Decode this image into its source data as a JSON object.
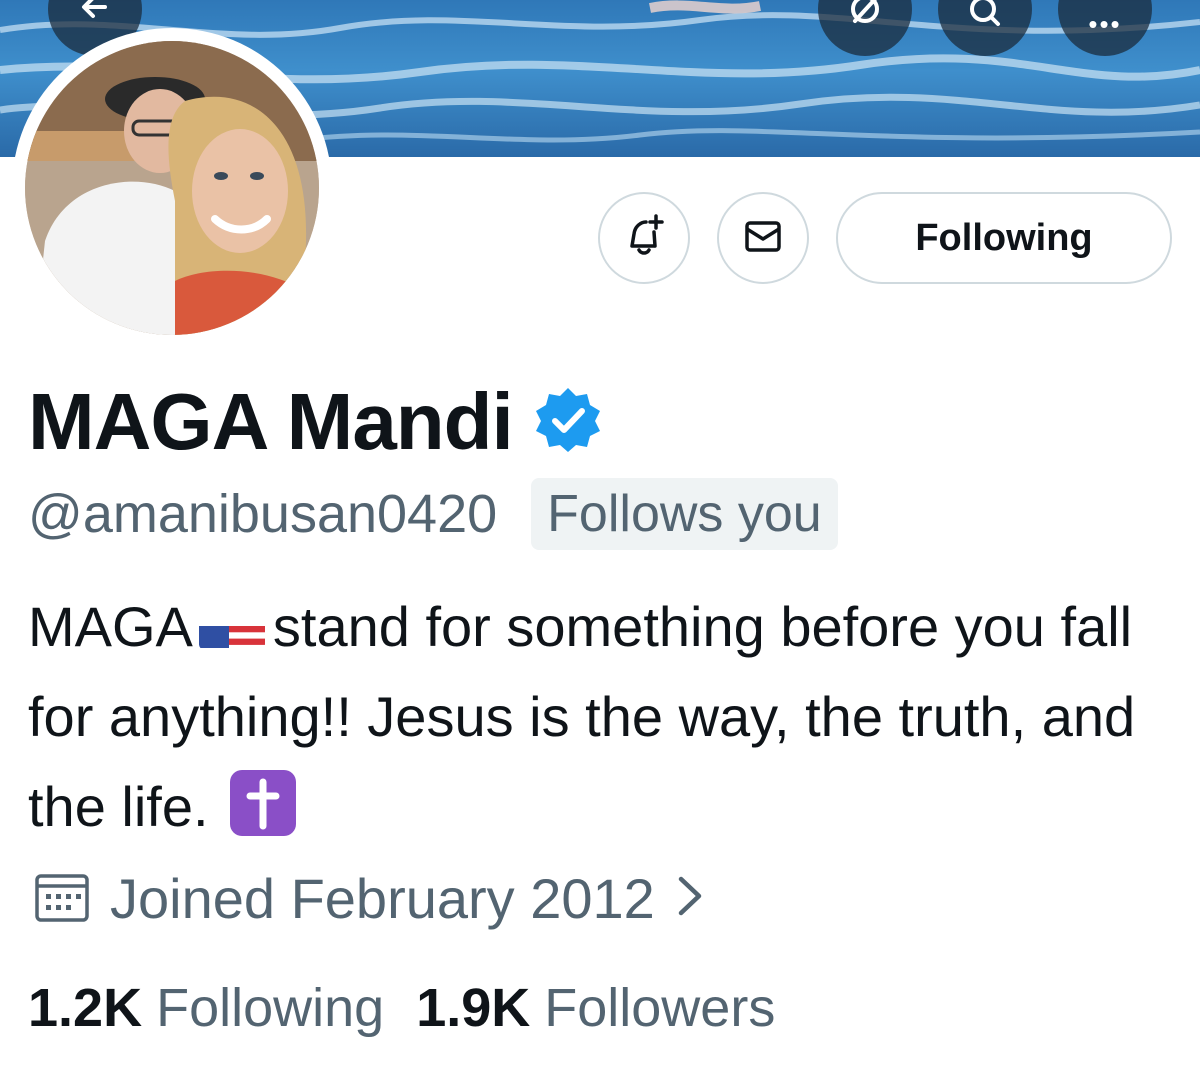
{
  "header": {
    "back_icon": "arrow-left-icon",
    "grok_icon": "grok-icon",
    "search_icon": "search-icon",
    "more_icon": "more-horizontal-icon",
    "more_glyph": "•••"
  },
  "actions": {
    "notify_icon": "bell-plus-icon",
    "message_icon": "mail-icon",
    "follow_label": "Following"
  },
  "profile": {
    "display_name": "MAGA Mandi",
    "verified_icon": "verified-badge-icon",
    "verified_color": "#1d9bf0",
    "handle": "@amanibusan0420",
    "follows_you": "Follows you"
  },
  "bio": {
    "part1": "MAGA",
    "flag_icon": "us-flag-icon",
    "part2": "stand for something before you fall for anything!! Jesus is the way, the truth, and the life.",
    "cross_icon": "latin-cross-icon"
  },
  "joined": {
    "icon": "calendar-icon",
    "text": "Joined February 2012",
    "chevron_icon": "chevron-right-icon"
  },
  "stats": {
    "following_count": "1.2K",
    "following_label": "Following",
    "followers_count": "1.9K",
    "followers_label": "Followers"
  },
  "colors": {
    "text_primary": "#0f1419",
    "text_secondary": "#536471",
    "border": "#cfd9de"
  }
}
